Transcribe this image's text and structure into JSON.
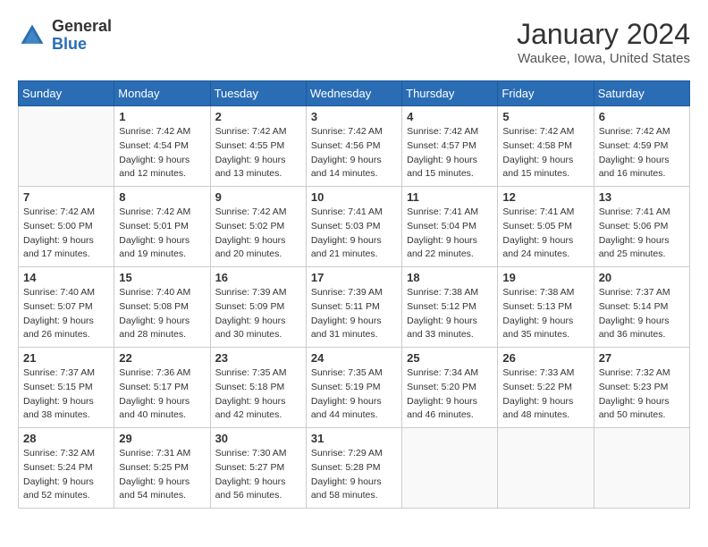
{
  "logo": {
    "general": "General",
    "blue": "Blue"
  },
  "title": "January 2024",
  "location": "Waukee, Iowa, United States",
  "weekdays": [
    "Sunday",
    "Monday",
    "Tuesday",
    "Wednesday",
    "Thursday",
    "Friday",
    "Saturday"
  ],
  "weeks": [
    [
      {
        "day": "",
        "sunrise": "",
        "sunset": "",
        "daylight": ""
      },
      {
        "day": "1",
        "sunrise": "Sunrise: 7:42 AM",
        "sunset": "Sunset: 4:54 PM",
        "daylight": "Daylight: 9 hours and 12 minutes."
      },
      {
        "day": "2",
        "sunrise": "Sunrise: 7:42 AM",
        "sunset": "Sunset: 4:55 PM",
        "daylight": "Daylight: 9 hours and 13 minutes."
      },
      {
        "day": "3",
        "sunrise": "Sunrise: 7:42 AM",
        "sunset": "Sunset: 4:56 PM",
        "daylight": "Daylight: 9 hours and 14 minutes."
      },
      {
        "day": "4",
        "sunrise": "Sunrise: 7:42 AM",
        "sunset": "Sunset: 4:57 PM",
        "daylight": "Daylight: 9 hours and 15 minutes."
      },
      {
        "day": "5",
        "sunrise": "Sunrise: 7:42 AM",
        "sunset": "Sunset: 4:58 PM",
        "daylight": "Daylight: 9 hours and 15 minutes."
      },
      {
        "day": "6",
        "sunrise": "Sunrise: 7:42 AM",
        "sunset": "Sunset: 4:59 PM",
        "daylight": "Daylight: 9 hours and 16 minutes."
      }
    ],
    [
      {
        "day": "7",
        "sunrise": "Sunrise: 7:42 AM",
        "sunset": "Sunset: 5:00 PM",
        "daylight": "Daylight: 9 hours and 17 minutes."
      },
      {
        "day": "8",
        "sunrise": "Sunrise: 7:42 AM",
        "sunset": "Sunset: 5:01 PM",
        "daylight": "Daylight: 9 hours and 19 minutes."
      },
      {
        "day": "9",
        "sunrise": "Sunrise: 7:42 AM",
        "sunset": "Sunset: 5:02 PM",
        "daylight": "Daylight: 9 hours and 20 minutes."
      },
      {
        "day": "10",
        "sunrise": "Sunrise: 7:41 AM",
        "sunset": "Sunset: 5:03 PM",
        "daylight": "Daylight: 9 hours and 21 minutes."
      },
      {
        "day": "11",
        "sunrise": "Sunrise: 7:41 AM",
        "sunset": "Sunset: 5:04 PM",
        "daylight": "Daylight: 9 hours and 22 minutes."
      },
      {
        "day": "12",
        "sunrise": "Sunrise: 7:41 AM",
        "sunset": "Sunset: 5:05 PM",
        "daylight": "Daylight: 9 hours and 24 minutes."
      },
      {
        "day": "13",
        "sunrise": "Sunrise: 7:41 AM",
        "sunset": "Sunset: 5:06 PM",
        "daylight": "Daylight: 9 hours and 25 minutes."
      }
    ],
    [
      {
        "day": "14",
        "sunrise": "Sunrise: 7:40 AM",
        "sunset": "Sunset: 5:07 PM",
        "daylight": "Daylight: 9 hours and 26 minutes."
      },
      {
        "day": "15",
        "sunrise": "Sunrise: 7:40 AM",
        "sunset": "Sunset: 5:08 PM",
        "daylight": "Daylight: 9 hours and 28 minutes."
      },
      {
        "day": "16",
        "sunrise": "Sunrise: 7:39 AM",
        "sunset": "Sunset: 5:09 PM",
        "daylight": "Daylight: 9 hours and 30 minutes."
      },
      {
        "day": "17",
        "sunrise": "Sunrise: 7:39 AM",
        "sunset": "Sunset: 5:11 PM",
        "daylight": "Daylight: 9 hours and 31 minutes."
      },
      {
        "day": "18",
        "sunrise": "Sunrise: 7:38 AM",
        "sunset": "Sunset: 5:12 PM",
        "daylight": "Daylight: 9 hours and 33 minutes."
      },
      {
        "day": "19",
        "sunrise": "Sunrise: 7:38 AM",
        "sunset": "Sunset: 5:13 PM",
        "daylight": "Daylight: 9 hours and 35 minutes."
      },
      {
        "day": "20",
        "sunrise": "Sunrise: 7:37 AM",
        "sunset": "Sunset: 5:14 PM",
        "daylight": "Daylight: 9 hours and 36 minutes."
      }
    ],
    [
      {
        "day": "21",
        "sunrise": "Sunrise: 7:37 AM",
        "sunset": "Sunset: 5:15 PM",
        "daylight": "Daylight: 9 hours and 38 minutes."
      },
      {
        "day": "22",
        "sunrise": "Sunrise: 7:36 AM",
        "sunset": "Sunset: 5:17 PM",
        "daylight": "Daylight: 9 hours and 40 minutes."
      },
      {
        "day": "23",
        "sunrise": "Sunrise: 7:35 AM",
        "sunset": "Sunset: 5:18 PM",
        "daylight": "Daylight: 9 hours and 42 minutes."
      },
      {
        "day": "24",
        "sunrise": "Sunrise: 7:35 AM",
        "sunset": "Sunset: 5:19 PM",
        "daylight": "Daylight: 9 hours and 44 minutes."
      },
      {
        "day": "25",
        "sunrise": "Sunrise: 7:34 AM",
        "sunset": "Sunset: 5:20 PM",
        "daylight": "Daylight: 9 hours and 46 minutes."
      },
      {
        "day": "26",
        "sunrise": "Sunrise: 7:33 AM",
        "sunset": "Sunset: 5:22 PM",
        "daylight": "Daylight: 9 hours and 48 minutes."
      },
      {
        "day": "27",
        "sunrise": "Sunrise: 7:32 AM",
        "sunset": "Sunset: 5:23 PM",
        "daylight": "Daylight: 9 hours and 50 minutes."
      }
    ],
    [
      {
        "day": "28",
        "sunrise": "Sunrise: 7:32 AM",
        "sunset": "Sunset: 5:24 PM",
        "daylight": "Daylight: 9 hours and 52 minutes."
      },
      {
        "day": "29",
        "sunrise": "Sunrise: 7:31 AM",
        "sunset": "Sunset: 5:25 PM",
        "daylight": "Daylight: 9 hours and 54 minutes."
      },
      {
        "day": "30",
        "sunrise": "Sunrise: 7:30 AM",
        "sunset": "Sunset: 5:27 PM",
        "daylight": "Daylight: 9 hours and 56 minutes."
      },
      {
        "day": "31",
        "sunrise": "Sunrise: 7:29 AM",
        "sunset": "Sunset: 5:28 PM",
        "daylight": "Daylight: 9 hours and 58 minutes."
      },
      {
        "day": "",
        "sunrise": "",
        "sunset": "",
        "daylight": ""
      },
      {
        "day": "",
        "sunrise": "",
        "sunset": "",
        "daylight": ""
      },
      {
        "day": "",
        "sunrise": "",
        "sunset": "",
        "daylight": ""
      }
    ]
  ]
}
